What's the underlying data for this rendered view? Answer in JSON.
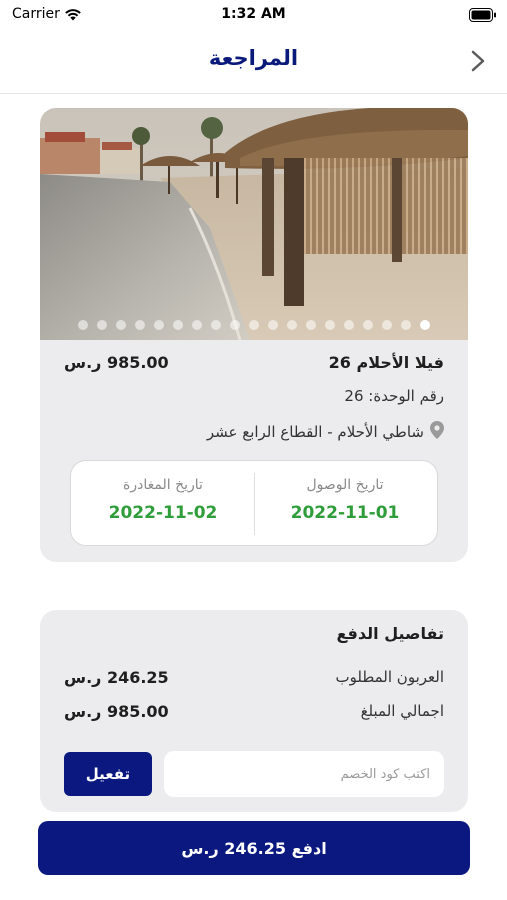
{
  "status_bar": {
    "carrier": "Carrier",
    "time": "1:32 AM"
  },
  "nav": {
    "title": "المراجعة",
    "back_icon": "chevron-right-icon"
  },
  "property": {
    "name": "فيلا الأحلام 26",
    "price": "985.00 ر.س",
    "unit": "رقم الوحدة: 26",
    "location": "شاطي الأحلام - القطاع الرابع عشر",
    "location_icon": "map-pin-icon",
    "gallery": {
      "total_images": 19,
      "active_index": 0
    }
  },
  "dates": {
    "arrival_label": "تاريخ الوصول",
    "arrival_value": "2022-11-01",
    "departure_label": "تاريخ المغادرة",
    "departure_value": "2022-11-02"
  },
  "payment": {
    "title": "تفاصيل الدفع",
    "deposit_label": "العربون المطلوب",
    "deposit_value": "246.25 ر.س",
    "total_label": "اجمالي المبلغ",
    "total_value": "985.00 ر.س",
    "promo_placeholder": "اكتب كود الخصم",
    "promo_value": "",
    "activate_label": "تفعيل"
  },
  "pay_button": {
    "label": "ادفع 246.25 ر.س"
  },
  "colors": {
    "brand": "#0b1880",
    "title": "#0a1a7a",
    "date_green": "#2e9d3a",
    "card_bg": "#ececee"
  }
}
